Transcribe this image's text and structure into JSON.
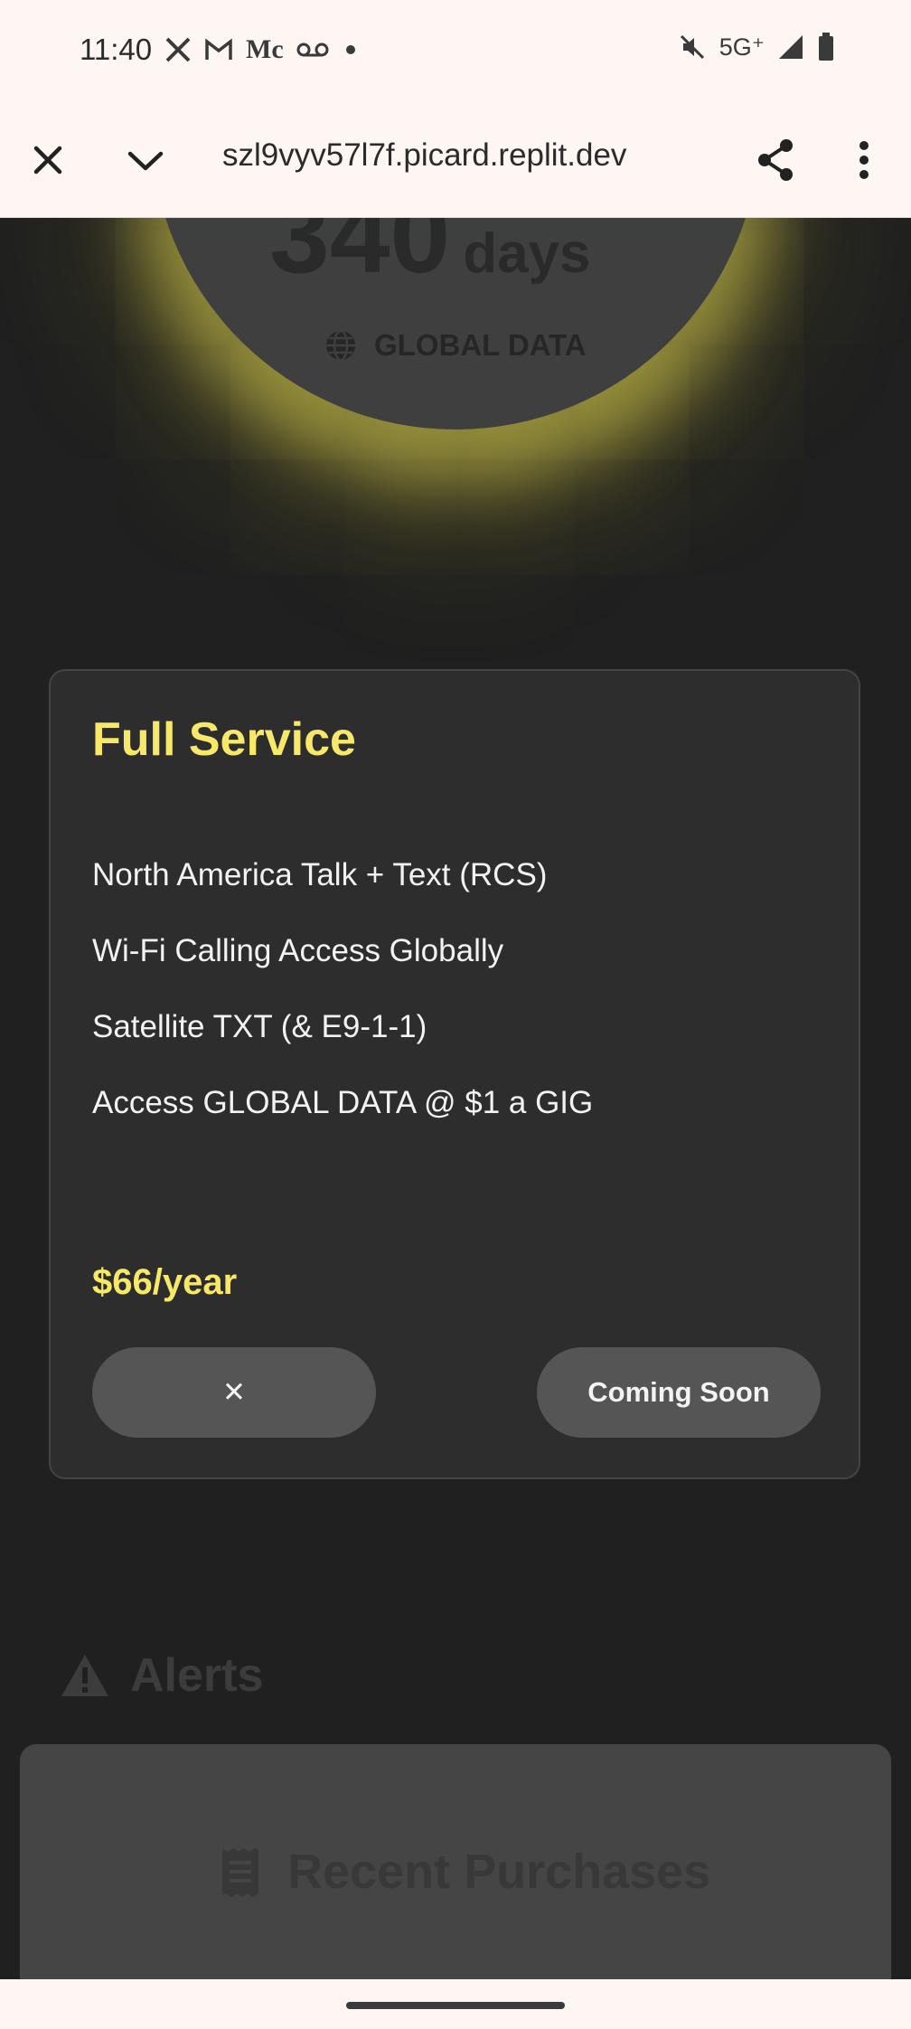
{
  "status_bar": {
    "time": "11:40",
    "left_icons": [
      "x-icon",
      "gmail-icon",
      "medium-icon",
      "voicemail-icon",
      "dot-icon"
    ],
    "network": "5G⁺",
    "right_icons": [
      "mute-icon",
      "signal-icon",
      "battery-icon"
    ]
  },
  "browser": {
    "url": "szl9vyv57l7f.picard.replit.dev"
  },
  "background": {
    "days_number": "340",
    "days_label": "days",
    "global_data_label": "GLOBAL DATA",
    "alerts_label": "Alerts",
    "recent_purchases_label": "Recent Purchases"
  },
  "modal": {
    "title": "Full Service",
    "features": [
      "North America Talk + Text (RCS)",
      "Wi-Fi Calling Access Globally",
      "Satellite TXT (& E9-1-1)",
      "Access GLOBAL DATA @ $1 a GIG"
    ],
    "price": "$66/year",
    "close_button_label": "✕",
    "action_button_label": "Coming Soon"
  },
  "colors": {
    "accent_yellow": "#f7e86a",
    "page_bg": "#202020",
    "card_bg": "#2d2d2d",
    "button_bg": "#555555"
  }
}
